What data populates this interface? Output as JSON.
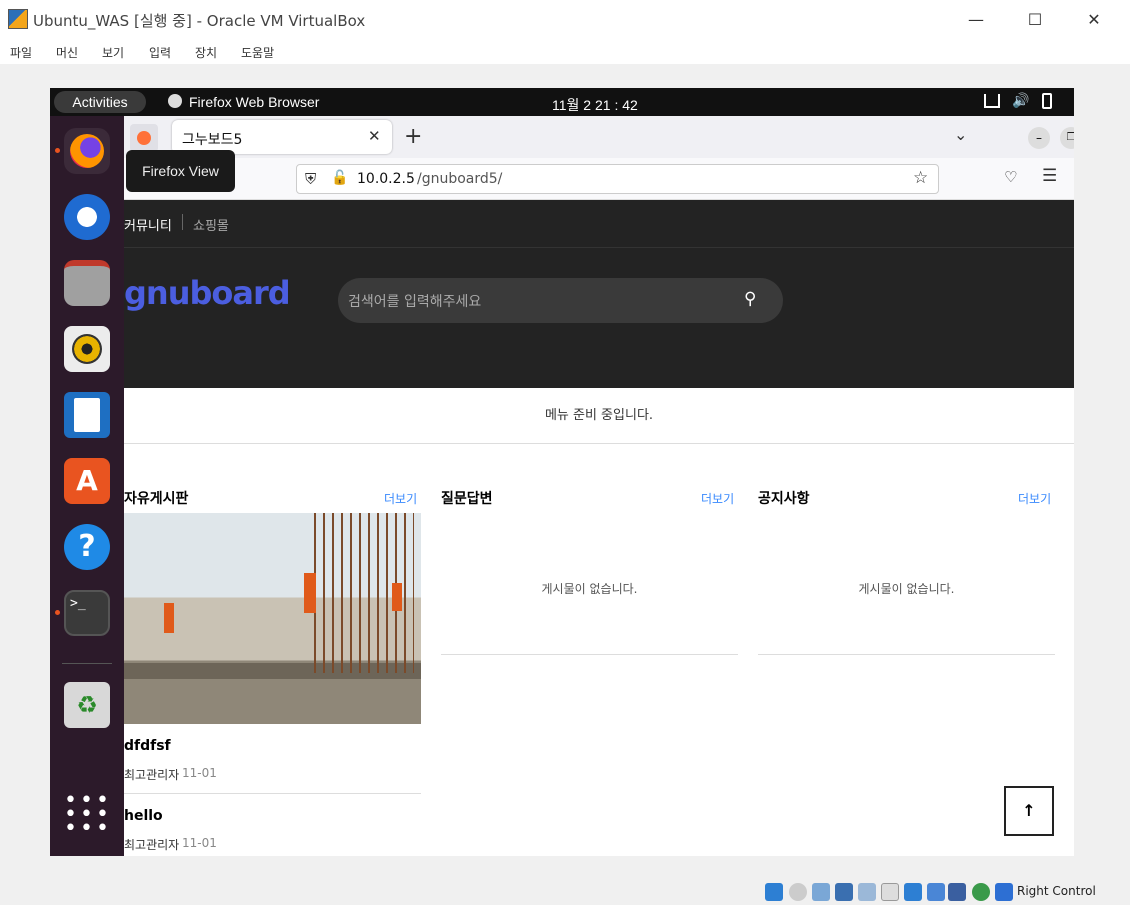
{
  "host": {
    "title": "Ubuntu_WAS [실행 중] - Oracle VM VirtualBox",
    "menu": [
      "파일",
      "머신",
      "보기",
      "입력",
      "장치",
      "도움말"
    ],
    "status_right": "Right Control"
  },
  "guest": {
    "activities": "Activities",
    "app_name": "Firefox Web Browser",
    "clock": "11월 2  21 : 42",
    "tooltip": "Firefox View",
    "dock_apps": [
      "firefox-icon",
      "thunderbird-icon",
      "files-icon",
      "rhythmbox-icon",
      "writer-icon",
      "software-icon",
      "help-icon",
      "terminal-icon",
      "trash-icon",
      "show-apps-icon"
    ]
  },
  "firefox": {
    "tab_title": "그누보드5",
    "url_host": "10.0.2.5",
    "url_path": "/gnuboard5/"
  },
  "site": {
    "top_links": [
      "커뮤니티",
      "쇼핑몰"
    ],
    "logo": "gnuboard",
    "search_placeholder": "검색어를 입력해주세요",
    "menu_notice": "메뉴 준비 중입니다.",
    "columns": [
      {
        "title": "자유게시판",
        "more": "더보기"
      },
      {
        "title": "질문답변",
        "more": "더보기",
        "empty": "게시물이 없습니다."
      },
      {
        "title": "공지사항",
        "more": "더보기",
        "empty": "게시물이 없습니다."
      }
    ],
    "posts": [
      {
        "title": "dfdfsf",
        "author": "최고관리자",
        "date": "11-01"
      },
      {
        "title": "hello",
        "author": "최고관리자",
        "date": "11-01"
      }
    ]
  }
}
